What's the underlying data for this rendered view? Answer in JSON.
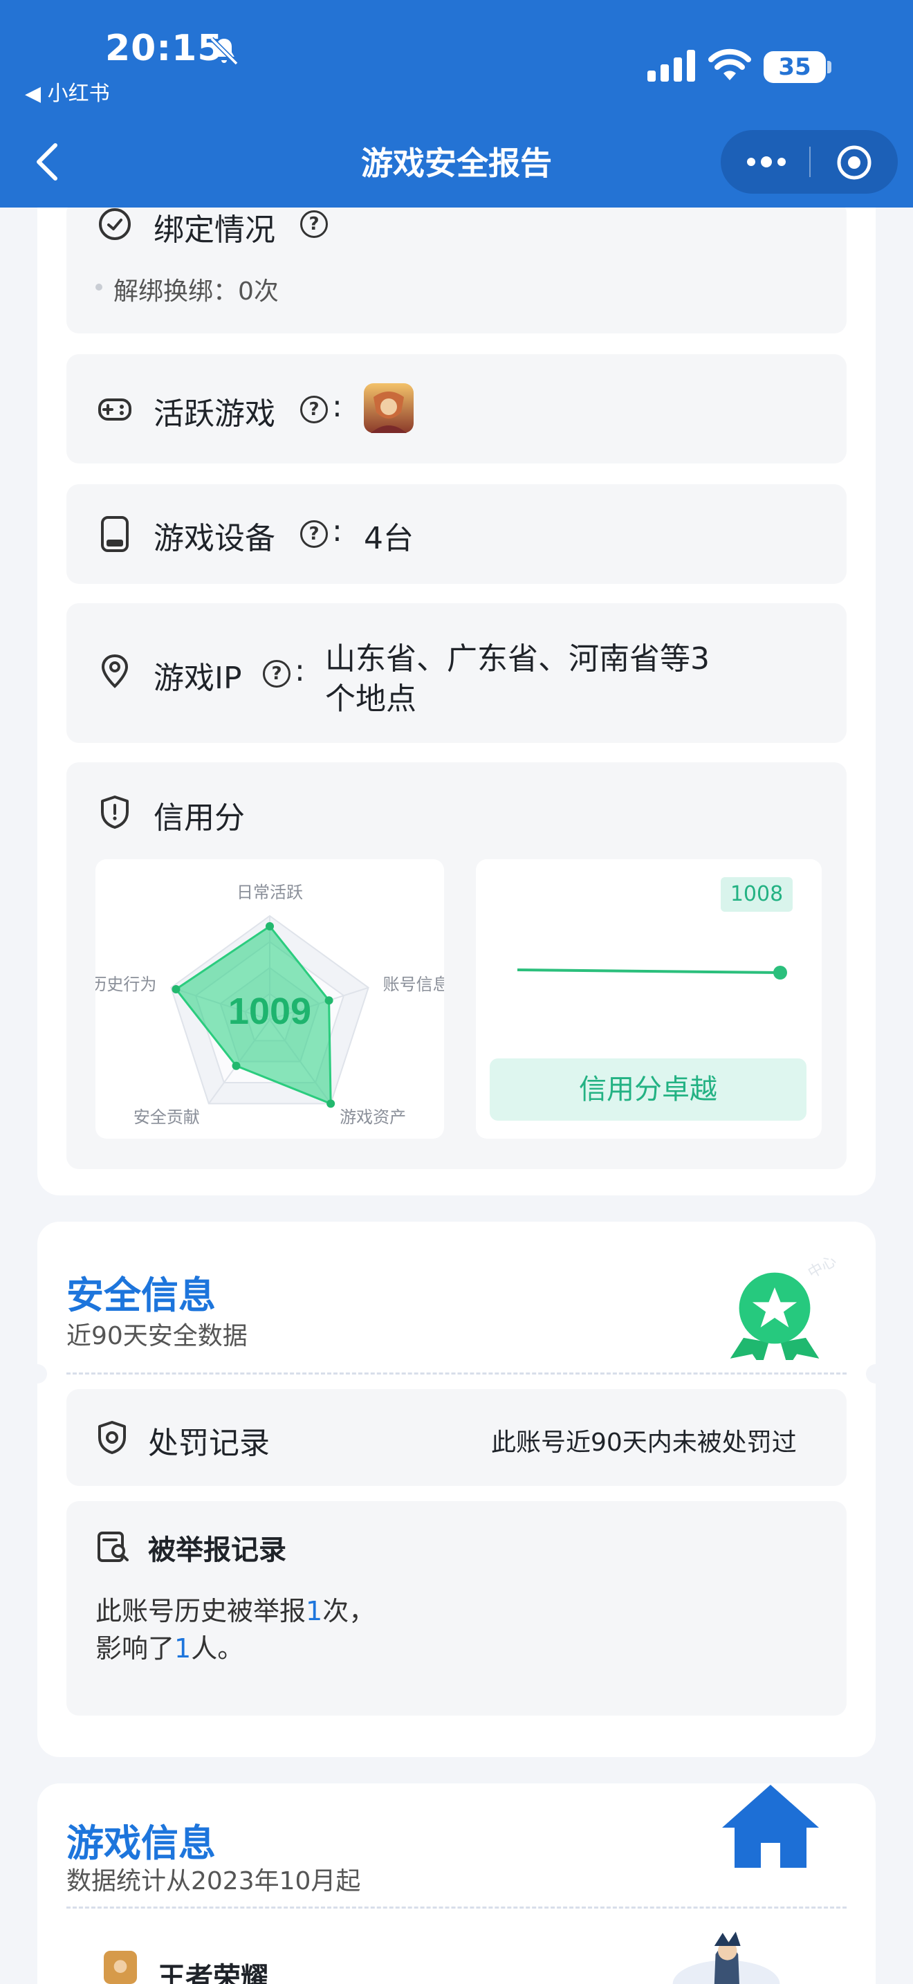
{
  "status_bar": {
    "time": "20:15",
    "back_app": "◀ 小红书",
    "battery": "35"
  },
  "nav": {
    "title": "游戏安全报告"
  },
  "binding": {
    "title": "绑定情况",
    "item": "解绑换绑：0次"
  },
  "active_game": {
    "title": "活跃游戏",
    "colon": ":"
  },
  "devices": {
    "title": "游戏设备",
    "colon": ":",
    "value": "4台"
  },
  "ip": {
    "title": "游戏IP",
    "colon": ":",
    "line1": "山东省、广东省、河南省等3",
    "line2": "个地点"
  },
  "credit": {
    "title": "信用分",
    "score": "1009",
    "level": "信用分卓越",
    "tag": "1008",
    "radar_labels": [
      "日常活跃",
      "账号信息",
      "游戏资产",
      "安全贡献",
      "历史行为"
    ]
  },
  "security": {
    "title": "安全信息",
    "subtitle": "近90天安全数据",
    "punish_title": "处罚记录",
    "punish_value": "此账号近90天内未被处罚过",
    "report_title": "被举报记录",
    "report_line1_a": "此账号历史被举报",
    "report_count": "1",
    "report_line1_b": "次，",
    "report_line2_a": "影响了",
    "report_people": "1",
    "report_line2_b": "人。"
  },
  "game_info": {
    "title": "游戏信息",
    "subtitle": "数据统计从2023年10月起",
    "game_name": "王者荣耀"
  },
  "colors": {
    "brand": "#2473d4",
    "accent": "#1d75dc",
    "green": "#23b283"
  },
  "chart_data": {
    "type": "radar",
    "categories": [
      "日常活跃",
      "账号信息",
      "游戏资产",
      "安全贡献",
      "历史行为"
    ],
    "series": [
      {
        "values": [
          0.9,
          0.6,
          1.0,
          0.55,
          0.95
        ]
      }
    ],
    "center_label": "1009"
  }
}
